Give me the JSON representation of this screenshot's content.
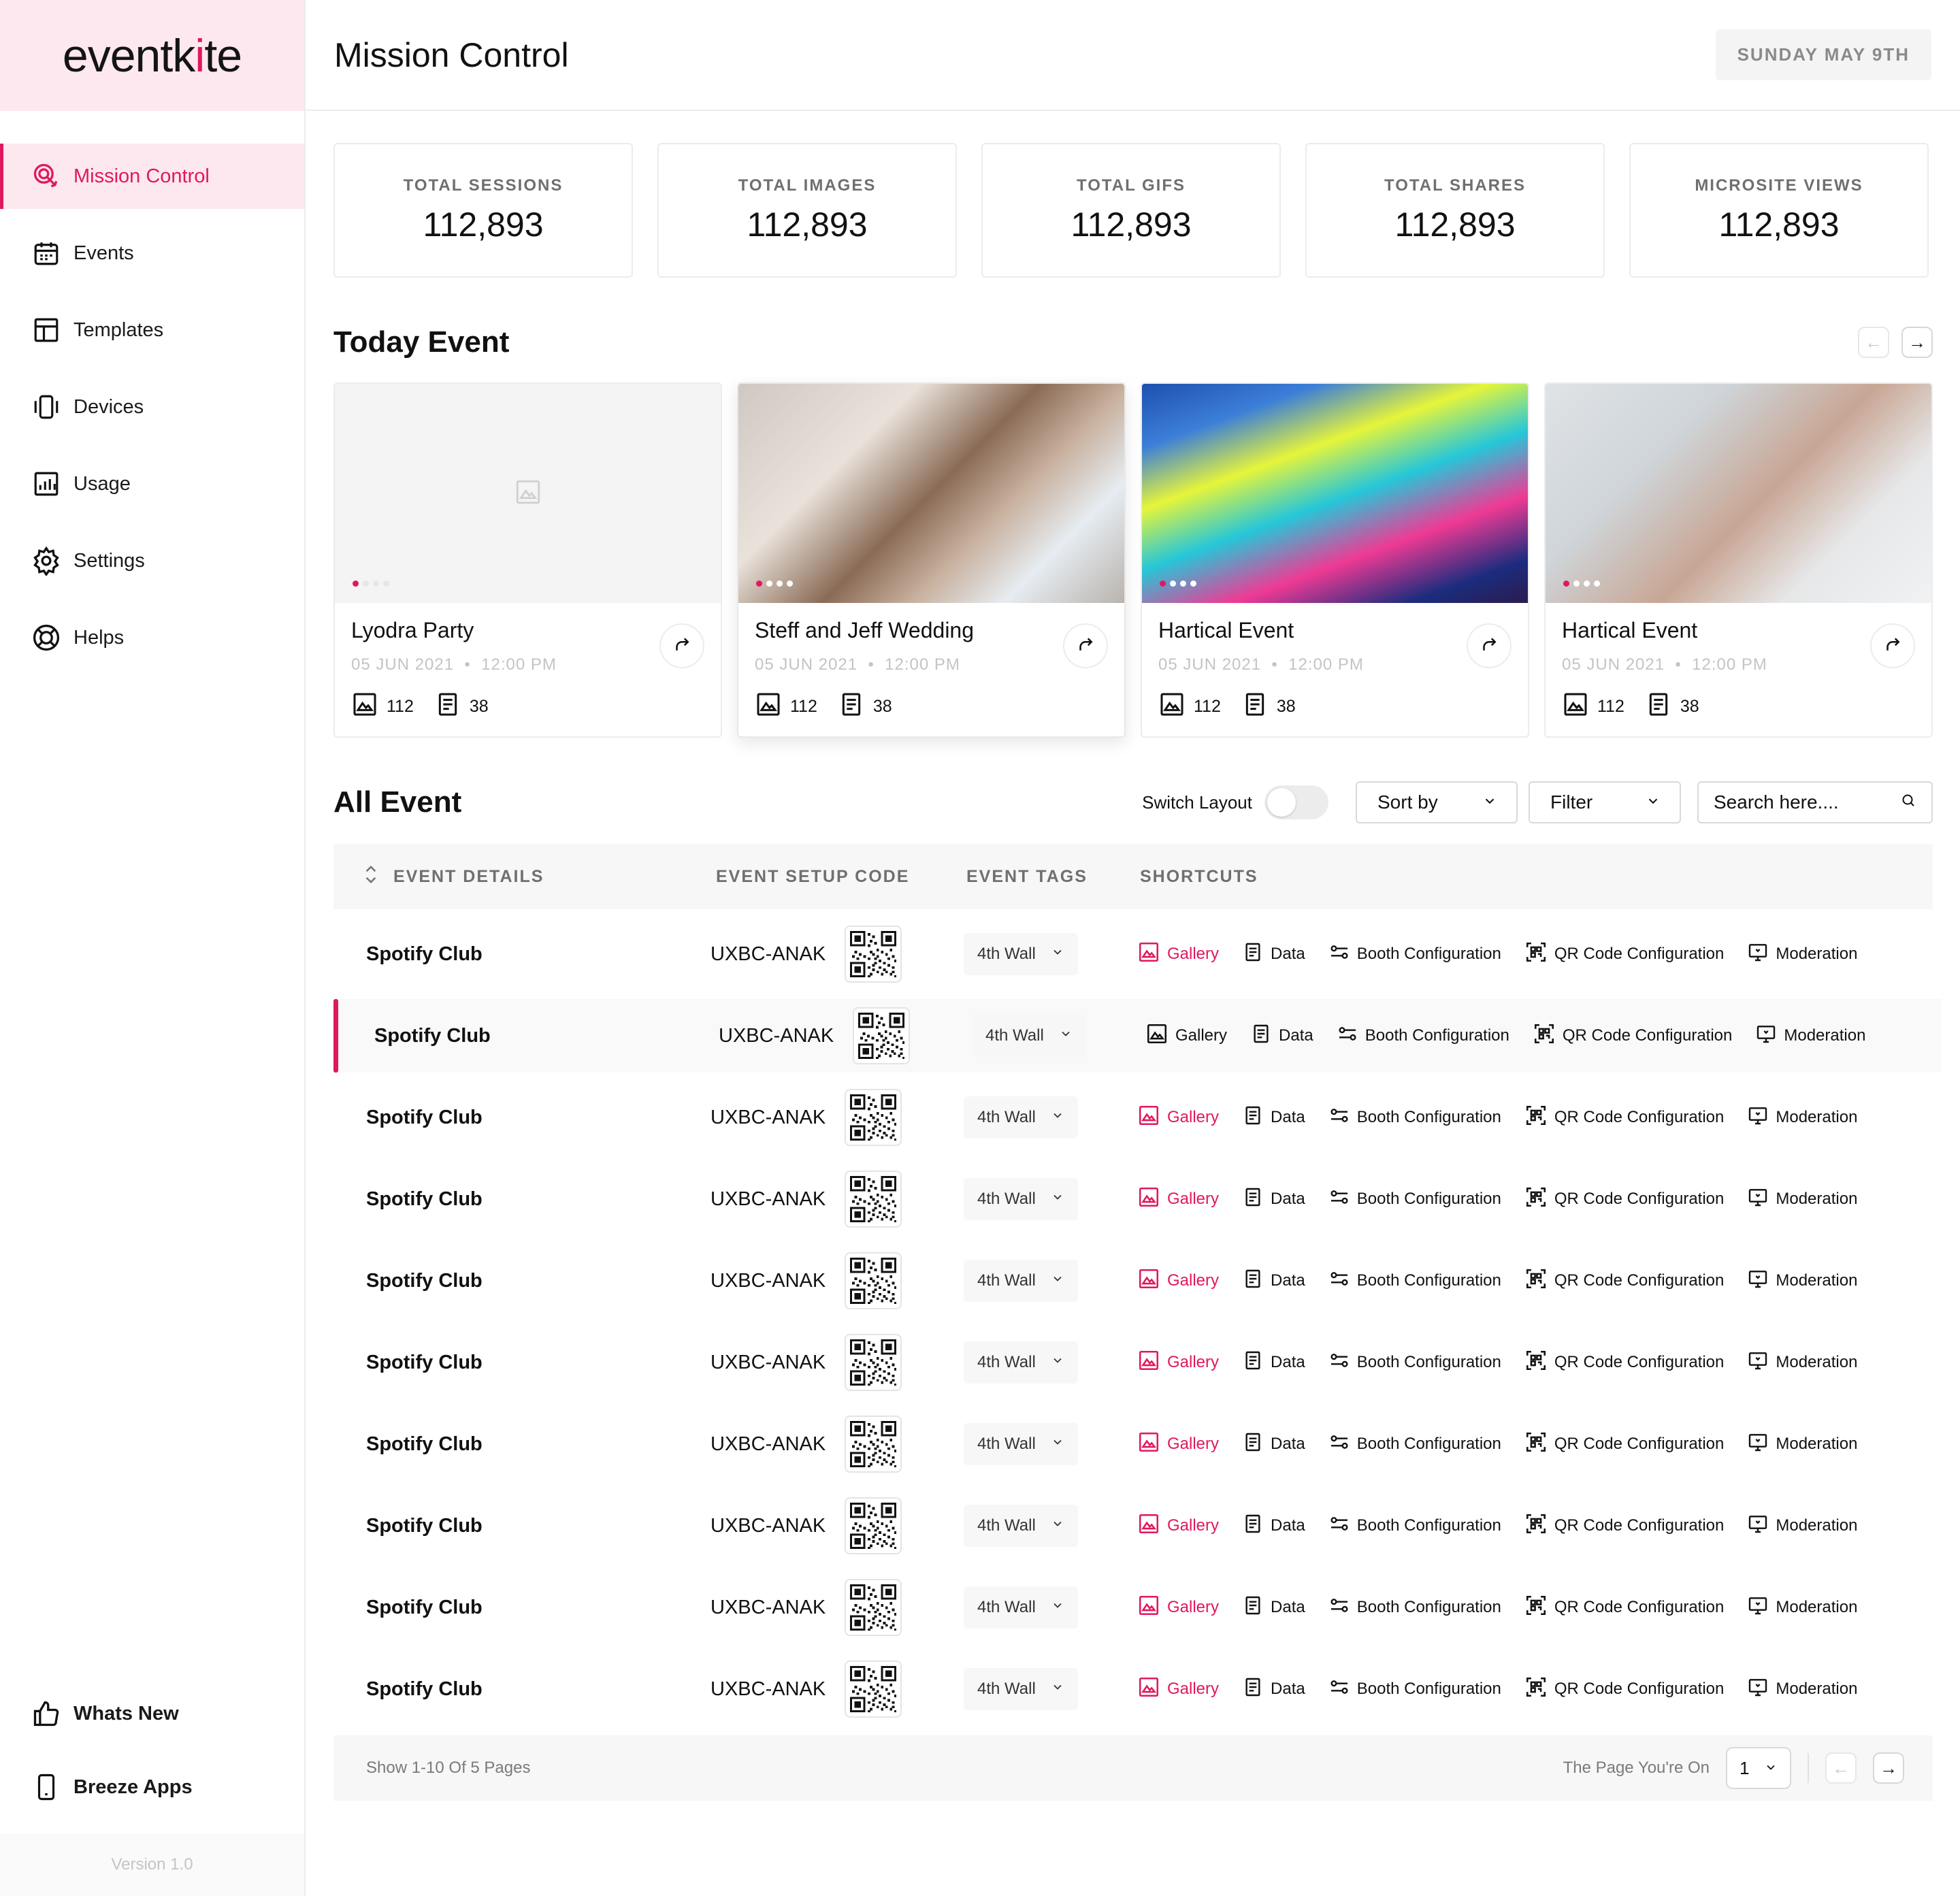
{
  "brand": {
    "logo_text_pre": "eventk",
    "logo_text_mid": "i",
    "logo_text_post": "te",
    "accent": "#e0185f"
  },
  "sidebar": {
    "items": [
      {
        "label": "Mission Control",
        "icon": "radar-icon",
        "active": true
      },
      {
        "label": "Events",
        "icon": "calendar-icon"
      },
      {
        "label": "Templates",
        "icon": "layout-icon"
      },
      {
        "label": "Devices",
        "icon": "device-icon"
      },
      {
        "label": "Usage",
        "icon": "chart-icon"
      },
      {
        "label": "Settings",
        "icon": "gear-icon"
      },
      {
        "label": "Helps",
        "icon": "lifebuoy-icon"
      }
    ],
    "bottom": [
      {
        "label": "Whats New",
        "icon": "thumbs-up-icon"
      },
      {
        "label": "Breeze Apps",
        "icon": "phone-icon"
      }
    ],
    "version": "Version 1.0"
  },
  "header": {
    "title": "Mission Control",
    "date": "SUNDAY MAY 9TH"
  },
  "stats": [
    {
      "label": "TOTAL SESSIONS",
      "value": "112,893"
    },
    {
      "label": "TOTAL IMAGES",
      "value": "112,893"
    },
    {
      "label": "TOTAL GIFS",
      "value": "112,893"
    },
    {
      "label": "TOTAL SHARES",
      "value": "112,893"
    },
    {
      "label": "MICROSITE VIEWS",
      "value": "112,893"
    }
  ],
  "today": {
    "title": "Today Event",
    "cards": [
      {
        "title": "Lyodra Party",
        "date": "05 JUN 2021",
        "time": "12:00 PM",
        "images": "112",
        "data": "38"
      },
      {
        "title": "Steff and Jeff Wedding",
        "date": "05 JUN 2021",
        "time": "12:00 PM",
        "images": "112",
        "data": "38"
      },
      {
        "title": "Hartical Event",
        "date": "05 JUN 2021",
        "time": "12:00 PM",
        "images": "112",
        "data": "38"
      },
      {
        "title": "Hartical Event",
        "date": "05 JUN 2021",
        "time": "12:00 PM",
        "images": "112",
        "data": "38"
      }
    ]
  },
  "all": {
    "title": "All Event",
    "switch_label": "Switch Layout",
    "sort_label": "Sort by",
    "filter_label": "Filter",
    "search_placeholder": "Search here....",
    "columns": [
      "EVENT DETAILS",
      "EVENT SETUP CODE",
      "EVENT TAGS",
      "SHORTCUTS"
    ],
    "shortcuts": [
      "Gallery",
      "Data",
      "Booth Configuration",
      "QR Code Configuration",
      "Moderation"
    ],
    "rows": [
      {
        "name": "Spotify Club",
        "code": "UXBC-ANAK",
        "tag": "4th Wall"
      },
      {
        "name": "Spotify Club",
        "code": "UXBC-ANAK",
        "tag": "4th Wall"
      },
      {
        "name": "Spotify Club",
        "code": "UXBC-ANAK",
        "tag": "4th Wall"
      },
      {
        "name": "Spotify Club",
        "code": "UXBC-ANAK",
        "tag": "4th Wall"
      },
      {
        "name": "Spotify Club",
        "code": "UXBC-ANAK",
        "tag": "4th Wall"
      },
      {
        "name": "Spotify Club",
        "code": "UXBC-ANAK",
        "tag": "4th Wall"
      },
      {
        "name": "Spotify Club",
        "code": "UXBC-ANAK",
        "tag": "4th Wall"
      },
      {
        "name": "Spotify Club",
        "code": "UXBC-ANAK",
        "tag": "4th Wall"
      },
      {
        "name": "Spotify Club",
        "code": "UXBC-ANAK",
        "tag": "4th Wall"
      },
      {
        "name": "Spotify Club",
        "code": "UXBC-ANAK",
        "tag": "4th Wall"
      }
    ],
    "pager": {
      "summary": "Show 1-10 Of 5 Pages",
      "label": "The Page You're On",
      "page": "1"
    }
  }
}
